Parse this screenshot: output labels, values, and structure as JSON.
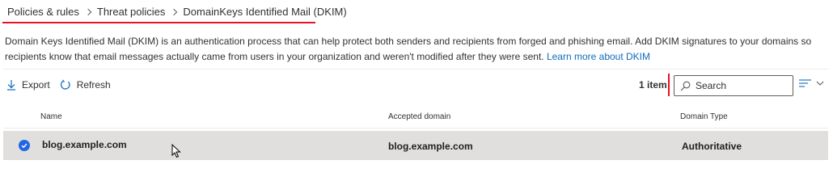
{
  "breadcrumb": {
    "items": [
      "Policies & rules",
      "Threat policies",
      "DomainKeys Identified Mail (DKIM)"
    ]
  },
  "description": {
    "text": "Domain Keys Identified Mail (DKIM) is an authentication process that can help protect both senders and recipients from forged and phishing email. Add DKIM signatures to your domains so recipients know that email messages actually came from users in your organization and weren't modified after they were sent. ",
    "link": "Learn more about DKIM"
  },
  "toolbar": {
    "export_label": "Export",
    "refresh_label": "Refresh"
  },
  "item_count": "1 item",
  "search": {
    "placeholder": "Search"
  },
  "table": {
    "columns": [
      "Name",
      "Accepted domain",
      "Domain Type"
    ],
    "rows": [
      {
        "name": "blog.example.com",
        "accepted_domain": "blog.example.com",
        "domain_type": "Authoritative",
        "selected": true
      }
    ]
  },
  "colors": {
    "accent": "#2266e3",
    "link": "#0f6cbd",
    "annotation": "#e81123",
    "selected_row": "#e1dfdd"
  }
}
